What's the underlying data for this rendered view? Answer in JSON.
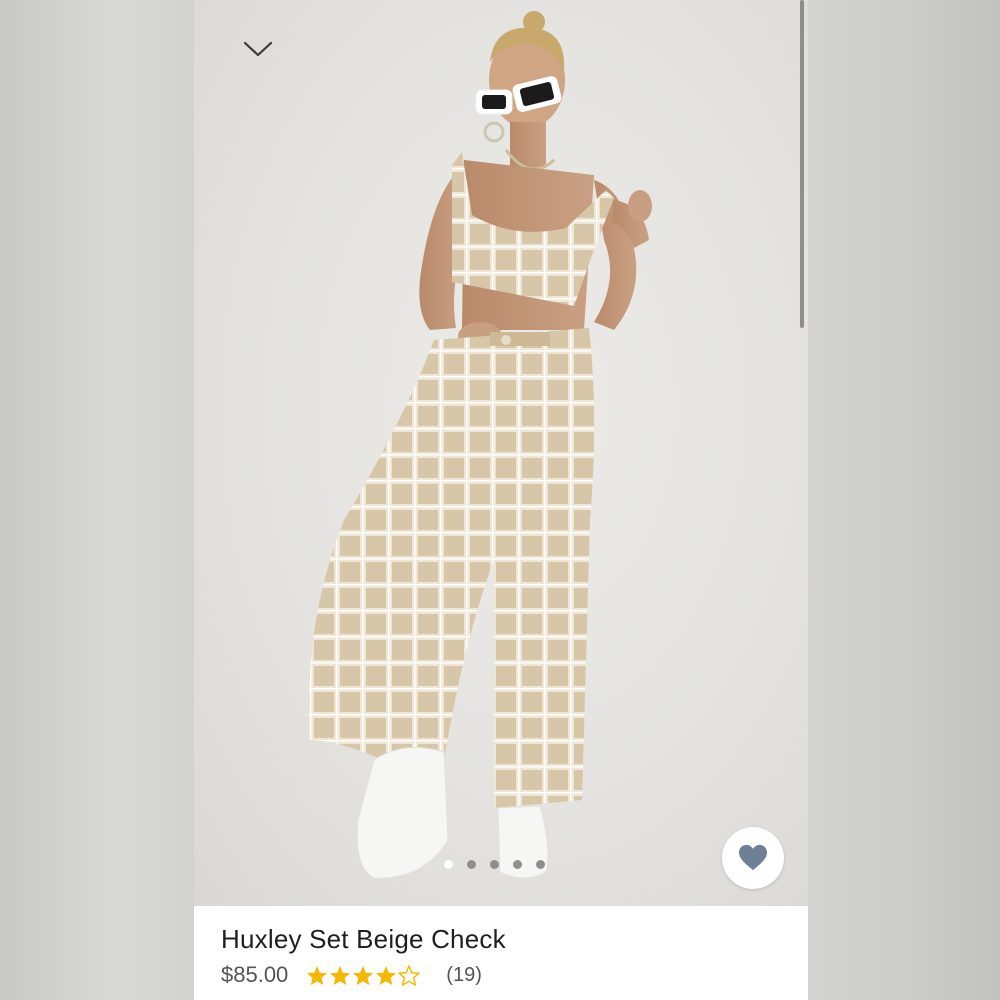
{
  "product": {
    "title": "Huxley Set Beige Check",
    "price": "$85.00",
    "rating": 4.5,
    "rating_count": "(19)"
  },
  "gallery": {
    "total_images": 5,
    "active_index": 0
  },
  "icons": {
    "back": "chevron-down-icon",
    "favorite": "heart-icon"
  },
  "colors": {
    "star": "#f5b800",
    "heart": "#6f7f95"
  }
}
